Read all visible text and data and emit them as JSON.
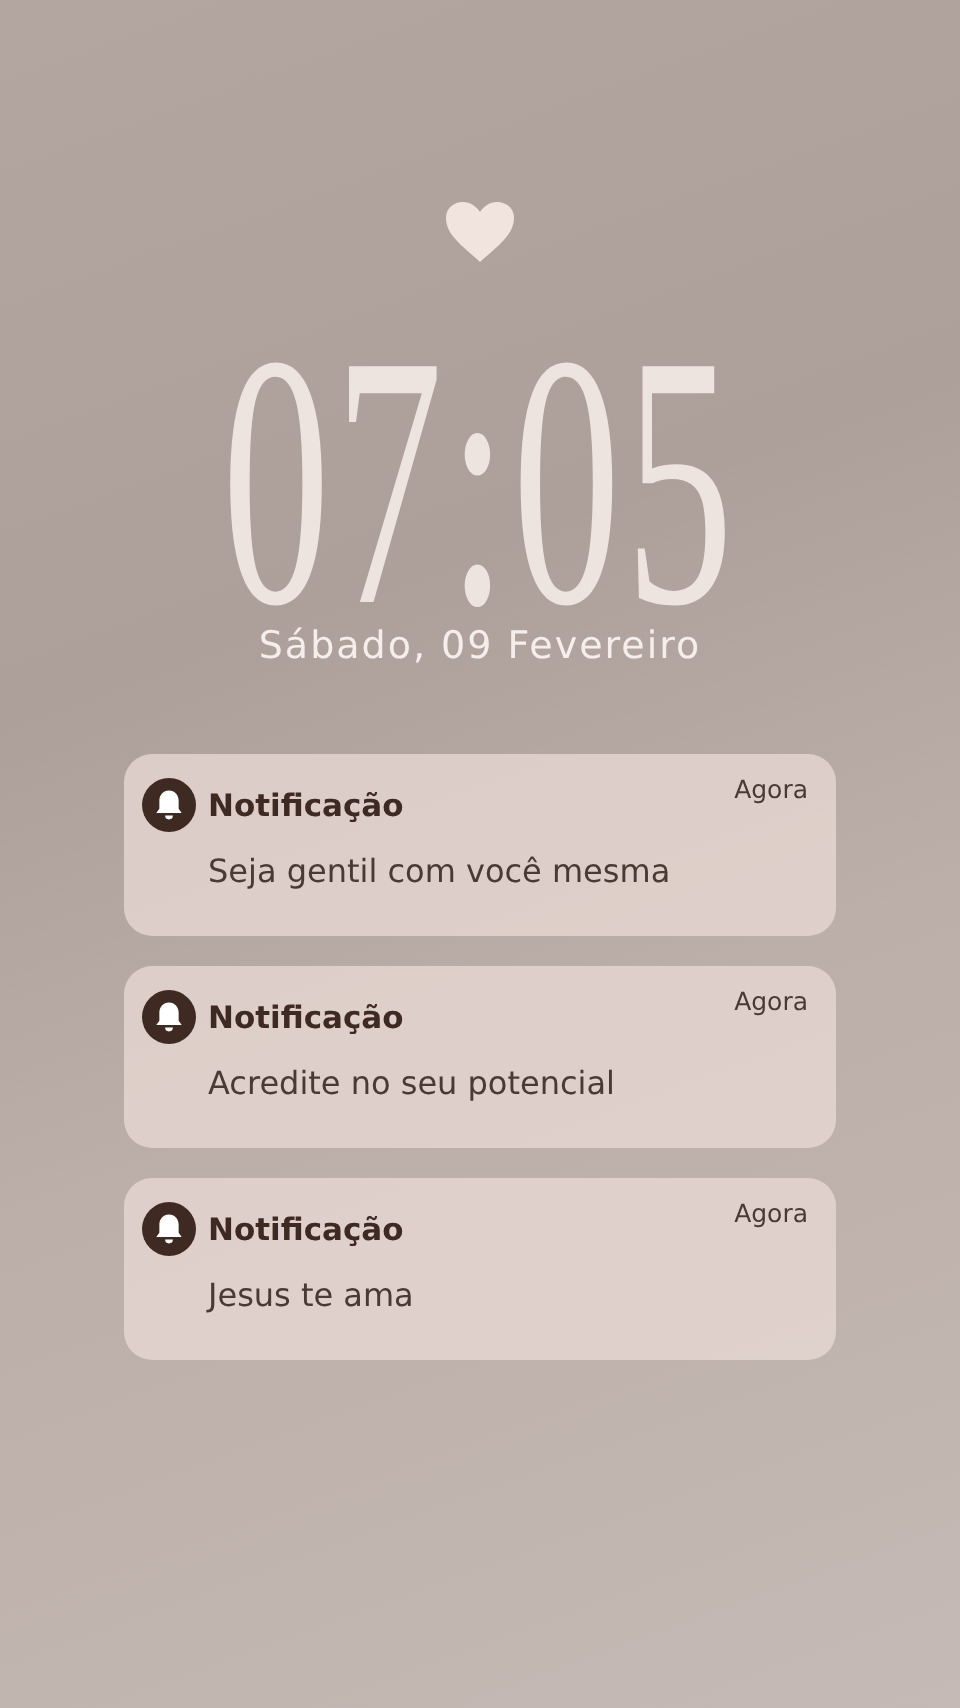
{
  "clock": {
    "time": "07:05",
    "date": "Sábado, 09 Fevereiro"
  },
  "notifications": [
    {
      "app": "Notificação",
      "time": "Agora",
      "message": "Seja gentil com você mesma"
    },
    {
      "app": "Notificação",
      "time": "Agora",
      "message": "Acredite no seu potencial"
    },
    {
      "app": "Notificação",
      "time": "Agora",
      "message": "Jesus te ama"
    }
  ]
}
